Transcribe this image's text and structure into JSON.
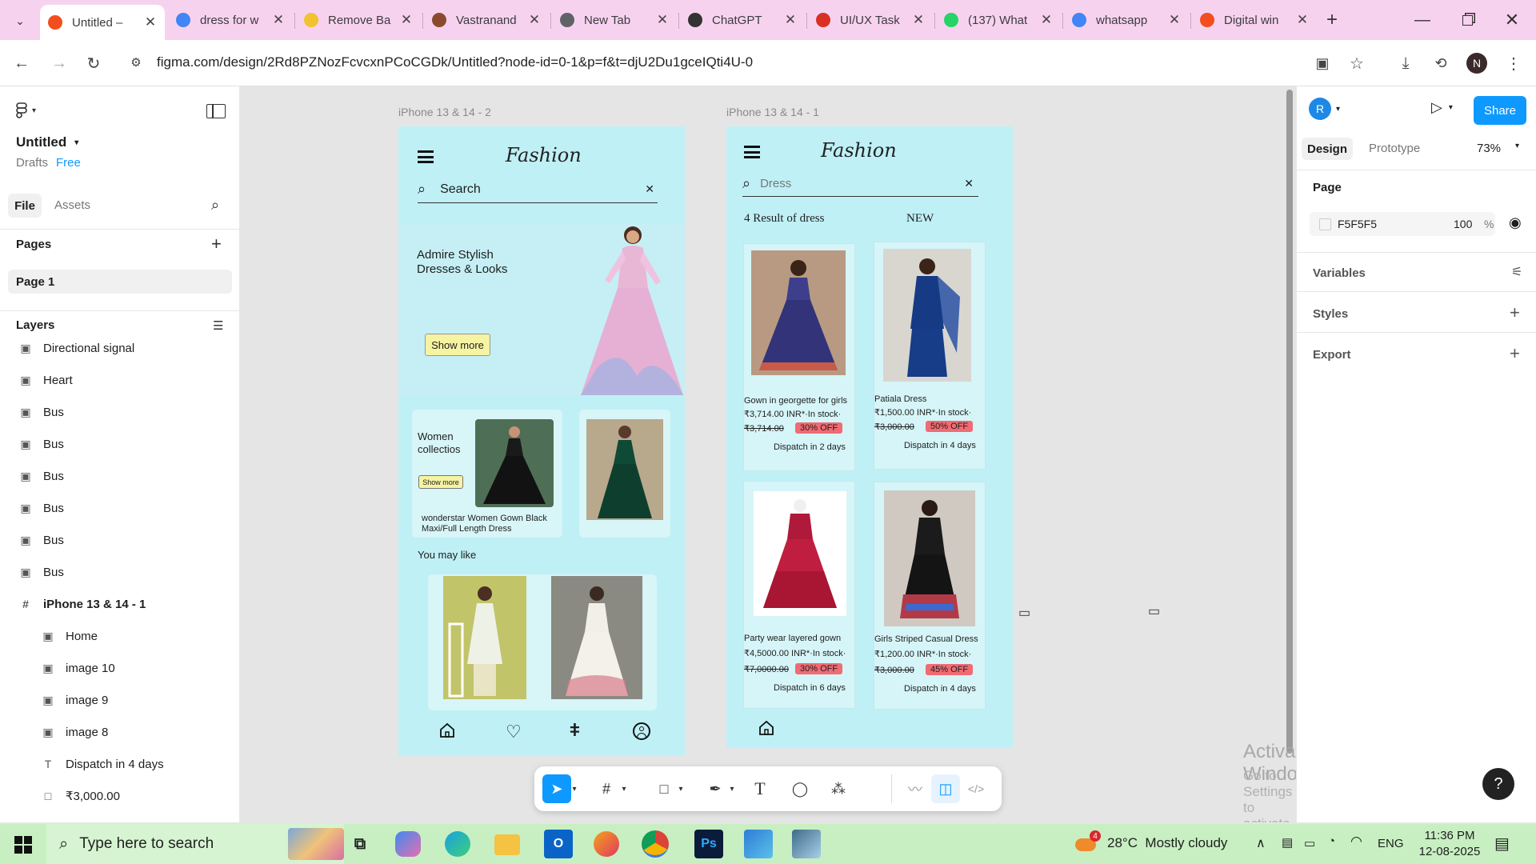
{
  "browser": {
    "tabs": [
      {
        "label": "Untitled – ",
        "icon": "figma-icon",
        "color": "#f24e1e",
        "active": true
      },
      {
        "label": "dress for w",
        "icon": "google-icon",
        "color": "#4285f4"
      },
      {
        "label": "Remove Ba",
        "icon": "removebg-icon",
        "color": "#f2c230"
      },
      {
        "label": "Vastranand",
        "icon": "vastranand-icon",
        "color": "#8a4b2d"
      },
      {
        "label": "New Tab",
        "icon": "chrome-icon",
        "color": "#5f6368"
      },
      {
        "label": "ChatGPT",
        "icon": "chatgpt-icon",
        "color": "#333333"
      },
      {
        "label": "UI/UX Task",
        "icon": "gmail-icon",
        "color": "#d93025"
      },
      {
        "label": "(137) What",
        "icon": "whatsapp-icon",
        "color": "#25d366"
      },
      {
        "label": "whatsapp",
        "icon": "google-icon",
        "color": "#4285f4"
      },
      {
        "label": "Digital win",
        "icon": "figma-icon",
        "color": "#f24e1e"
      }
    ],
    "url": "figma.com/design/2Rd8PZNozFcvcxnPCoCGDk/Untitled?node-id=0-1&p=f&t=djU2Du1gceIQti4U-0",
    "profile_initial": "N"
  },
  "left_panel": {
    "file_name": "Untitled",
    "drafts": "Drafts",
    "plan": "Free",
    "tab_file": "File",
    "tab_assets": "Assets",
    "pages_heading": "Pages",
    "page_item": "Page 1",
    "layers_heading": "Layers",
    "layers": [
      {
        "name": "Directional signal",
        "type": "image",
        "child": false
      },
      {
        "name": "Heart",
        "type": "image",
        "child": false
      },
      {
        "name": "Bus",
        "type": "image",
        "child": false
      },
      {
        "name": "Bus",
        "type": "image",
        "child": false
      },
      {
        "name": "Bus",
        "type": "image",
        "child": false
      },
      {
        "name": "Bus",
        "type": "image",
        "child": false
      },
      {
        "name": "Bus",
        "type": "image",
        "child": false
      },
      {
        "name": "Bus",
        "type": "image",
        "child": false
      },
      {
        "name": "iPhone 13 & 14 - 1",
        "type": "frame",
        "child": false
      },
      {
        "name": "Home",
        "type": "image",
        "child": true
      },
      {
        "name": "image 10",
        "type": "image",
        "child": true
      },
      {
        "name": "image 9",
        "type": "image",
        "child": true
      },
      {
        "name": "image 8",
        "type": "image",
        "child": true
      },
      {
        "name": "Dispatch in 4 days",
        "type": "text",
        "child": true
      },
      {
        "name": "₹3,000.00",
        "type": "rect",
        "child": true
      },
      {
        "name": "30% OFF",
        "type": "text",
        "child": true
      }
    ]
  },
  "frame2": {
    "label": "iPhone 13 & 14 - 2",
    "brand": "Fashion",
    "search_placeholder": "Search",
    "hero_title": "Admire Stylish Dresses & Looks",
    "hero_button": "Show more",
    "collection_title": "Women collectios",
    "collection_button": "Show more",
    "collection_caption": "wonderstar Women Gown Black Maxi/Full Length Dress",
    "you_may_like": "You may like"
  },
  "frame1": {
    "label": "iPhone 13 & 14 - 1",
    "brand": "Fashion",
    "search_value": "Dress",
    "result_text": "4 Result of dress",
    "new_text": "NEW",
    "products": [
      {
        "name": "Gown in georgette for girls",
        "price": "₹3,714.00 INR*·In stock·",
        "mrp": "₹3,714.00",
        "discount": "30% OFF",
        "dispatch": "Dispatch in 2 days"
      },
      {
        "name": "Patiala Dress",
        "price": "₹1,500.00 INR*·In stock·",
        "mrp": "₹3,000.00",
        "discount": "50% OFF",
        "dispatch": "Dispatch in 4 days"
      },
      {
        "name": "Party wear layered gown",
        "price": "₹4,5000.00 INR*·In stock·",
        "mrp": "₹7,0000.00",
        "discount": "30% OFF",
        "dispatch": "Dispatch in 6 days"
      },
      {
        "name": "Girls Striped Casual Dress",
        "price": "₹1,200.00 INR*·In stock·",
        "mrp": "₹3,000.00",
        "discount": "45% OFF",
        "dispatch": "Dispatch in 4 days"
      }
    ]
  },
  "right_panel": {
    "avatar_initial": "R",
    "share": "Share",
    "tab_design": "Design",
    "tab_prototype": "Prototype",
    "zoom": "73%",
    "page_heading": "Page",
    "page_color": "F5F5F5",
    "page_opacity": "100",
    "percent": "%",
    "variables": "Variables",
    "styles": "Styles",
    "export": "Export"
  },
  "watermark": {
    "title": "Activate Windows",
    "subtitle": "Go to Settings to activate Windows."
  },
  "taskbar": {
    "search_placeholder": "Type here to search",
    "weather_badge": "4",
    "weather": "28°C  Mostly cloudy",
    "language": "ENG",
    "time": "11:36 PM",
    "date": "12-08-2025"
  },
  "colors": {
    "tabstrip": "#f7d2ef",
    "frame_bg": "#bff0f6",
    "accent": "#0d99ff",
    "discount": "#f06b73",
    "taskbar": "#c8efc2"
  }
}
